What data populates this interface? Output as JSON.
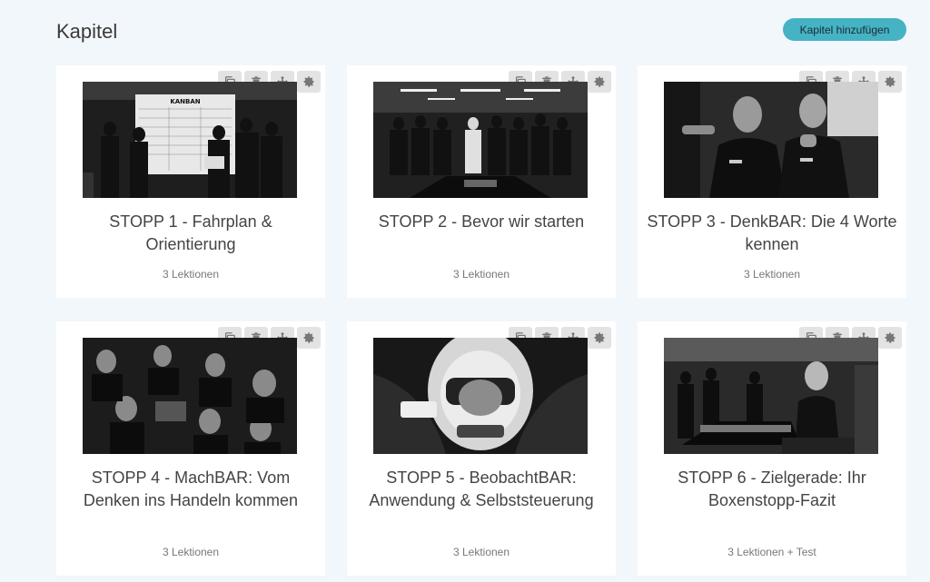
{
  "header": {
    "title": "Kapitel",
    "add_button_label": "Kapitel hinzufügen"
  },
  "colors": {
    "accent": "#45b3c4",
    "background": "#f2f7fb",
    "card": "#ffffff",
    "tool_bg": "#e3e3e3"
  },
  "toolbar_icons": [
    "copy-icon",
    "trash-icon",
    "move-icon",
    "gear-icon"
  ],
  "chapters": [
    {
      "title": "STOPP 1 - Fahrplan & Orientierung",
      "meta": "3 Lektionen",
      "image_icon": "kanban-board-meeting-image",
      "image_text": "KANBAN"
    },
    {
      "title": "STOPP 2 - Bevor wir starten",
      "meta": "3 Lektionen",
      "image_icon": "pit-crew-team-image"
    },
    {
      "title": "STOPP 3 - DenkBAR: Die 4 Worte kennen",
      "meta": "3 Lektionen",
      "image_icon": "two-engineers-pointing-image"
    },
    {
      "title": "STOPP 4 - MachBAR: Vom Denken ins Handeln kommen",
      "meta": "3 Lektionen",
      "image_icon": "race-team-collage-image"
    },
    {
      "title": "STOPP 5 - BeobachtBAR: Anwendung & Selbststeuerung",
      "meta": "3 Lektionen",
      "image_icon": "driver-helmet-image"
    },
    {
      "title": "STOPP 6 - Zielgerade: Ihr Boxenstopp-Fazit",
      "meta": "3 Lektionen + Test",
      "image_icon": "woman-pit-lane-image"
    }
  ]
}
